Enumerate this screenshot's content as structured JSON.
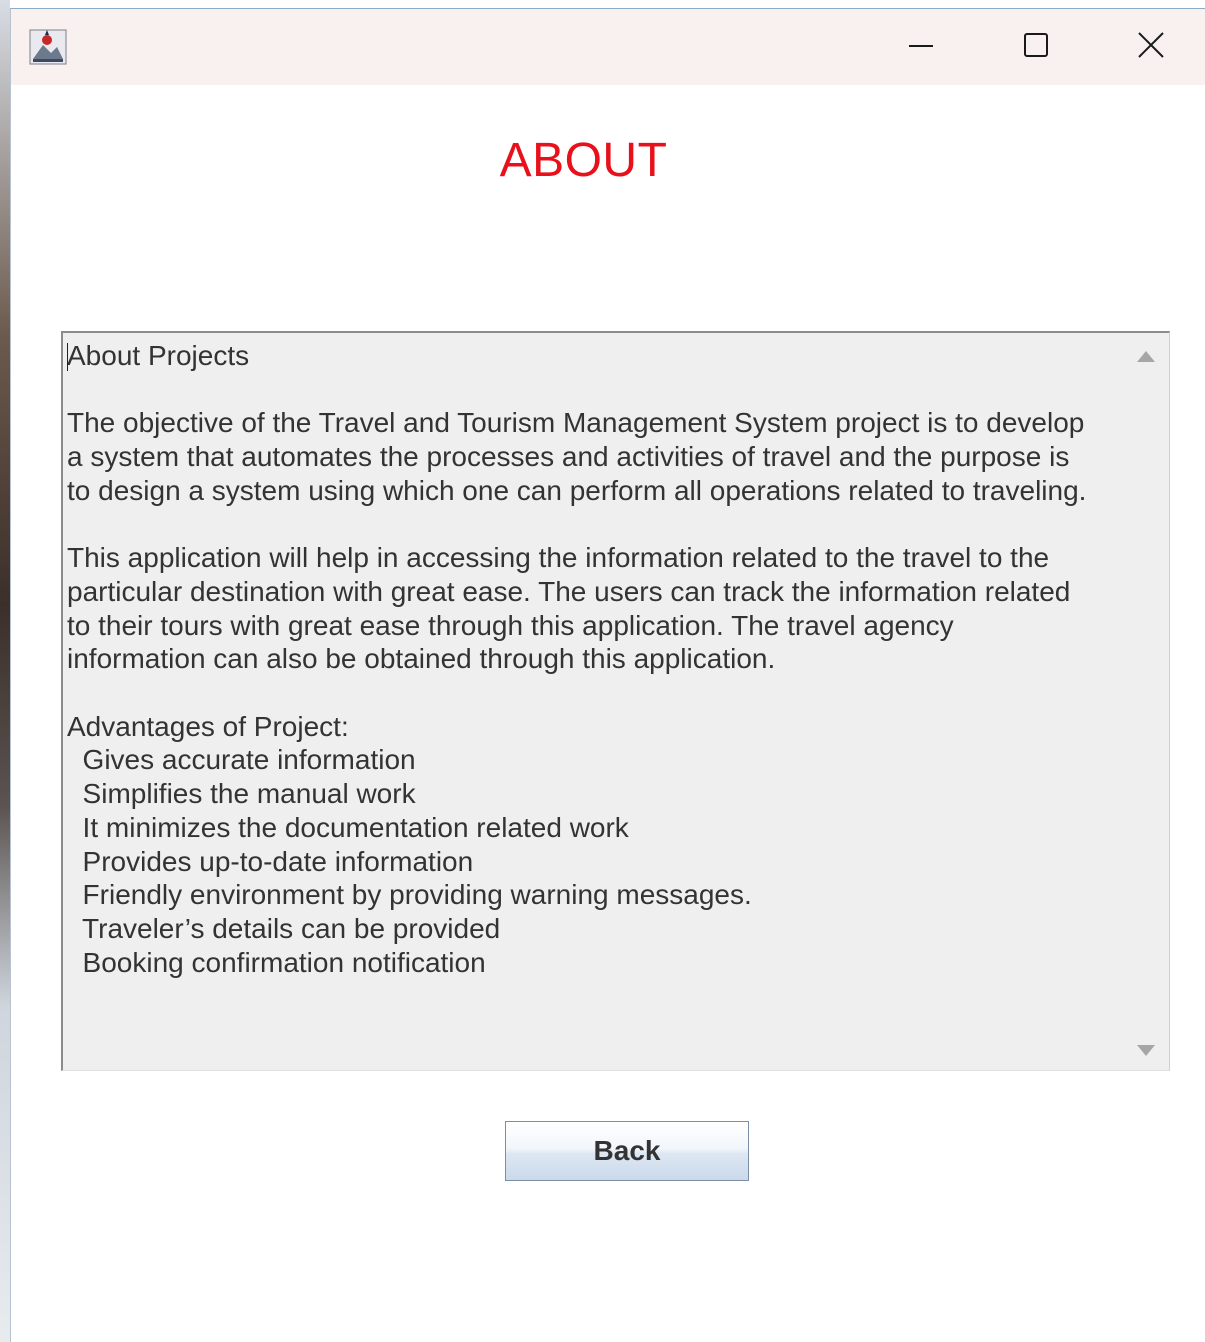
{
  "titlebar": {
    "app_icon": "java-app-icon",
    "minimize_icon": "minimize-icon",
    "maximize_icon": "maximize-icon",
    "close_icon": "close-icon"
  },
  "page": {
    "title": "ABOUT",
    "title_color": "#e8111b"
  },
  "about_text": "About Projects\n\nThe objective of the Travel and Tourism Management System project is to develop\na system that automates the processes and activities of travel and the purpose is\nto design a system using which one can perform all operations related to traveling.\n\nThis application will help in accessing the information related to the travel to the\nparticular destination with great ease. The users can track the information related\nto their tours with great ease through this application. The travel agency\ninformation can also be obtained through this application.\n\nAdvantages of Project:\n  Gives accurate information\n  Simplifies the manual work\n  It minimizes the documentation related work\n  Provides up-to-date information\n  Friendly environment by providing warning messages.\n  Traveler’s details can be provided\n  Booking confirmation notification",
  "buttons": {
    "back_label": "Back"
  }
}
